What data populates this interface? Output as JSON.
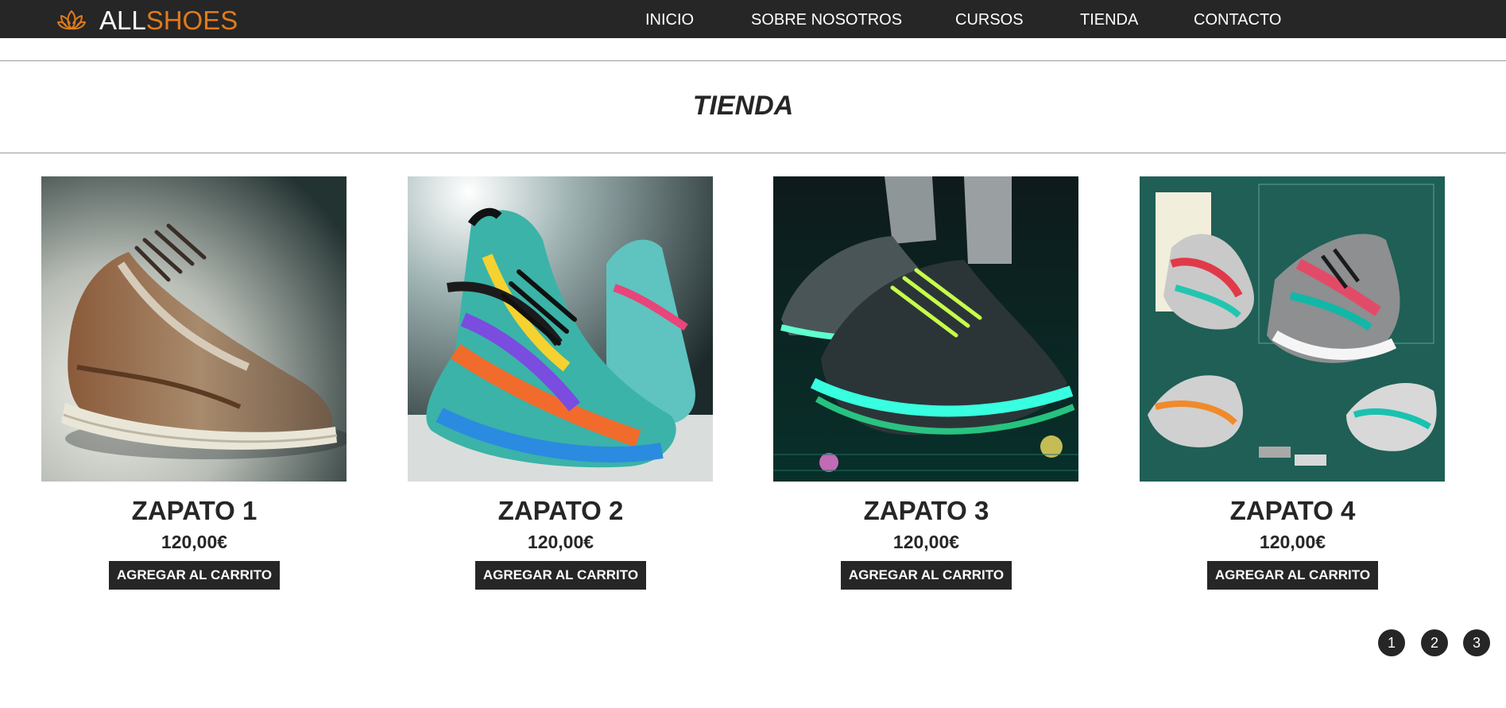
{
  "header": {
    "brand_part1": "ALL",
    "brand_part2": "SHOES",
    "logo_icon": "lotus-icon",
    "nav": [
      {
        "label": "INICIO"
      },
      {
        "label": "SOBRE NOSOTROS"
      },
      {
        "label": "CURSOS"
      },
      {
        "label": "TIENDA"
      },
      {
        "label": "CONTACTO"
      }
    ]
  },
  "page": {
    "title": "TIENDA"
  },
  "products": [
    {
      "name": "ZAPATO 1",
      "price": "120,00€",
      "button": "AGREGAR AL CARRITO"
    },
    {
      "name": "ZAPATO 2",
      "price": "120,00€",
      "button": "AGREGAR AL CARRITO"
    },
    {
      "name": "ZAPATO 3",
      "price": "120,00€",
      "button": "AGREGAR AL CARRITO"
    },
    {
      "name": "ZAPATO 4",
      "price": "120,00€",
      "button": "AGREGAR AL CARRITO"
    }
  ],
  "pagination": [
    {
      "label": "1"
    },
    {
      "label": "2"
    },
    {
      "label": "3"
    }
  ],
  "colors": {
    "navbar": "#262626",
    "accent": "#e07b1a",
    "button": "#262626",
    "text": "#262626"
  }
}
